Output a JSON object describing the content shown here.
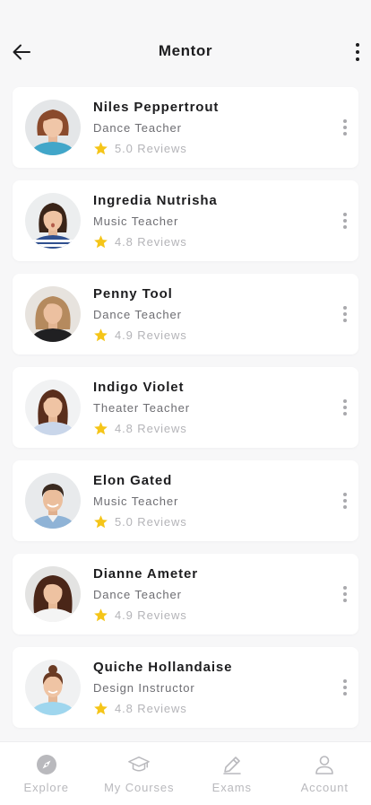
{
  "header": {
    "title": "Mentor"
  },
  "mentors": [
    {
      "name": "Niles Peppertrout",
      "role": "Dance Teacher",
      "reviews": "5.0 Reviews"
    },
    {
      "name": "Ingredia Nutrisha",
      "role": "Music Teacher",
      "reviews": "4.8 Reviews"
    },
    {
      "name": "Penny Tool",
      "role": "Dance Teacher",
      "reviews": "4.9 Reviews"
    },
    {
      "name": "Indigo Violet",
      "role": "Theater Teacher",
      "reviews": "4.8 Reviews"
    },
    {
      "name": "Elon Gated",
      "role": "Music Teacher",
      "reviews": "5.0 Reviews"
    },
    {
      "name": "Dianne Ameter",
      "role": "Dance Teacher",
      "reviews": "4.9 Reviews"
    },
    {
      "name": "Quiche Hollandaise",
      "role": "Design Instructor",
      "reviews": "4.8 Reviews"
    }
  ],
  "tabbar": {
    "items": [
      {
        "label": "Explore",
        "icon": "compass-icon"
      },
      {
        "label": "My Courses",
        "icon": "graduation-cap-icon"
      },
      {
        "label": "Exams",
        "icon": "pencil-icon"
      },
      {
        "label": "Account",
        "icon": "user-icon"
      }
    ]
  },
  "colors": {
    "background": "#f7f7f8",
    "card": "#ffffff",
    "star": "#f5c518",
    "muted_text": "#b4b4b8",
    "tab_icon": "#b9b9bd"
  }
}
